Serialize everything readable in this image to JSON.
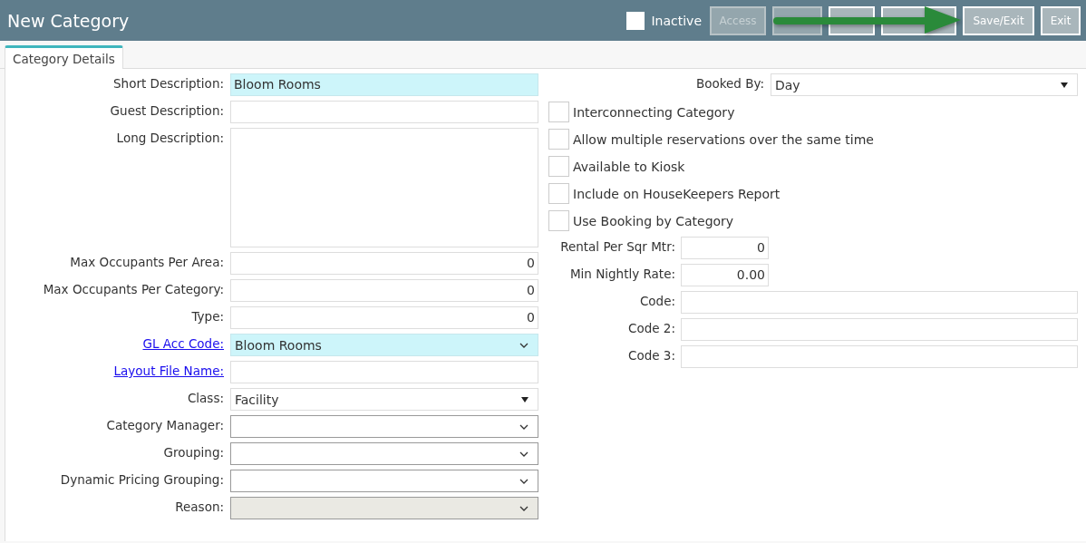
{
  "window": {
    "title": "New Category"
  },
  "inactive": {
    "label": "Inactive",
    "checked": false
  },
  "buttons": [
    {
      "label": "Access",
      "disabled": true
    },
    {
      "disabled": true
    },
    {
      "disabled": false
    },
    {
      "disabled": false
    },
    {
      "label": "Save/Exit",
      "disabled": false
    },
    {
      "label": "Exit",
      "disabled": false
    }
  ],
  "tabs": [
    {
      "label": "Category Details",
      "selected": true
    }
  ],
  "left_fields": [
    {
      "label": "Short Description:",
      "kind": "text",
      "value": "Bloom Rooms",
      "highlighted": true,
      "link": false,
      "disabled": false
    },
    {
      "label": "Guest Description:",
      "kind": "text",
      "highlighted": false,
      "link": false,
      "disabled": false
    },
    {
      "label": "Long Description:",
      "kind": "textarea",
      "highlighted": false,
      "link": false,
      "disabled": false
    },
    {
      "label": "Max Occupants Per Area:",
      "kind": "number",
      "value": "0",
      "highlighted": false,
      "link": false,
      "disabled": false
    },
    {
      "label": "Max Occupants Per Category:",
      "kind": "number",
      "value": "0",
      "highlighted": false,
      "link": false,
      "disabled": false
    },
    {
      "label": "Type:",
      "kind": "number",
      "value": "0",
      "highlighted": false,
      "link": false,
      "disabled": false
    },
    {
      "label": "GL Acc Code:",
      "kind": "combo",
      "value": "Bloom Rooms",
      "highlighted": true,
      "link": true,
      "disabled": false
    },
    {
      "label": "Layout File Name:",
      "kind": "text",
      "highlighted": false,
      "link": true,
      "disabled": false
    },
    {
      "label": "Class:",
      "kind": "select",
      "value": "Facility",
      "highlighted": false,
      "link": false,
      "disabled": false
    },
    {
      "label": "Category Manager:",
      "kind": "combo",
      "highlighted": false,
      "link": false,
      "disabled": false
    },
    {
      "label": "Grouping:",
      "kind": "combo",
      "highlighted": false,
      "link": false,
      "disabled": false
    },
    {
      "label": "Dynamic Pricing Grouping:",
      "kind": "combo",
      "highlighted": false,
      "link": false,
      "disabled": false
    },
    {
      "label": "Reason:",
      "kind": "combo",
      "highlighted": false,
      "link": false,
      "disabled": true
    }
  ],
  "booked_by": {
    "label": "Booked By:",
    "value": "Day"
  },
  "options": [
    {
      "label": "Interconnecting Category",
      "checked": false
    },
    {
      "label": "Allow multiple reservations over the same time",
      "checked": false
    },
    {
      "label": "Available to Kiosk",
      "checked": false
    },
    {
      "label": "Include on HouseKeepers Report",
      "checked": false
    },
    {
      "label": "Use Booking by Category",
      "checked": false
    }
  ],
  "right_fields": [
    {
      "label": "Rental Per Sqr Mtr:",
      "kind": "short",
      "value": "0"
    },
    {
      "label": "Min Nightly Rate:",
      "kind": "short",
      "value": "0.00"
    },
    {
      "label": "Code:",
      "kind": "wide"
    },
    {
      "label": "Code 2:",
      "kind": "wide"
    },
    {
      "label": "Code 3:",
      "kind": "wide"
    }
  ]
}
